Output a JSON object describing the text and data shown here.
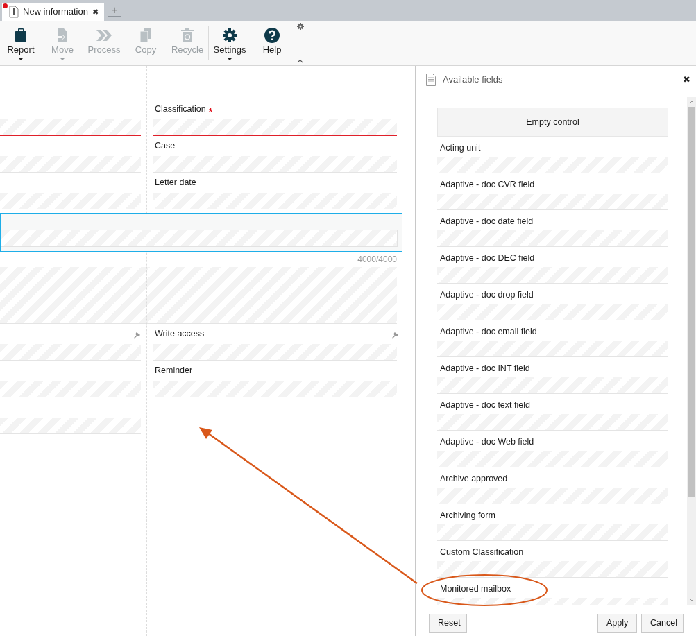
{
  "tab": {
    "title": "New information",
    "unsaved": true,
    "close": "✖",
    "add": "+"
  },
  "toolbar": [
    {
      "kind": "report",
      "label": "Report",
      "disabled": false,
      "dropdown": true
    },
    {
      "kind": "move",
      "label": "Move",
      "disabled": true,
      "dropdown": true
    },
    {
      "kind": "process",
      "label": "Process",
      "disabled": true,
      "dropdown": false
    },
    {
      "kind": "copy",
      "label": "Copy",
      "disabled": true,
      "dropdown": false
    },
    {
      "kind": "recycle",
      "label": "Recycle",
      "disabled": true,
      "dropdown": false
    },
    {
      "kind": "settings",
      "label": "Settings",
      "disabled": false,
      "dropdown": true,
      "separator_before": true
    },
    {
      "kind": "help",
      "label": "Help",
      "disabled": false,
      "dropdown": false,
      "separator_before": true
    }
  ],
  "form": {
    "rows": [
      {
        "kind": "pair",
        "label": "Classification",
        "marker": "*",
        "required": true,
        "left_required": true,
        "locked": false
      },
      {
        "kind": "pair",
        "label": "Case",
        "required": false,
        "left_required": false,
        "locked": false
      },
      {
        "kind": "pair",
        "label": "Letter date",
        "required": false,
        "left_required": false,
        "locked": false
      },
      {
        "kind": "memo",
        "selected": true,
        "counter": "4000/4000"
      },
      {
        "kind": "textarea"
      },
      {
        "kind": "pair",
        "label": "Write access",
        "required": false,
        "left_required": false,
        "locked": true
      },
      {
        "kind": "pair",
        "label": "Reminder",
        "required": false,
        "left_required": false,
        "locked": false
      },
      {
        "kind": "left"
      }
    ]
  },
  "panel": {
    "title": "Available fields",
    "close": "✖",
    "empty_control": "Empty control",
    "items": [
      "Acting unit",
      "Adaptive - doc CVR field",
      "Adaptive - doc date field",
      "Adaptive - doc DEC field",
      "Adaptive - doc drop field",
      "Adaptive - doc email field",
      "Adaptive - doc INT field",
      "Adaptive - doc text field",
      "Adaptive - doc Web field",
      "Archive approved",
      "Archiving form",
      "Custom Classification",
      "Monitored mailbox"
    ],
    "buttons": [
      {
        "kind": "reset",
        "label": "Reset"
      },
      {
        "kind": "apply",
        "label": "Apply"
      },
      {
        "kind": "cancel",
        "label": "Cancel"
      }
    ]
  }
}
